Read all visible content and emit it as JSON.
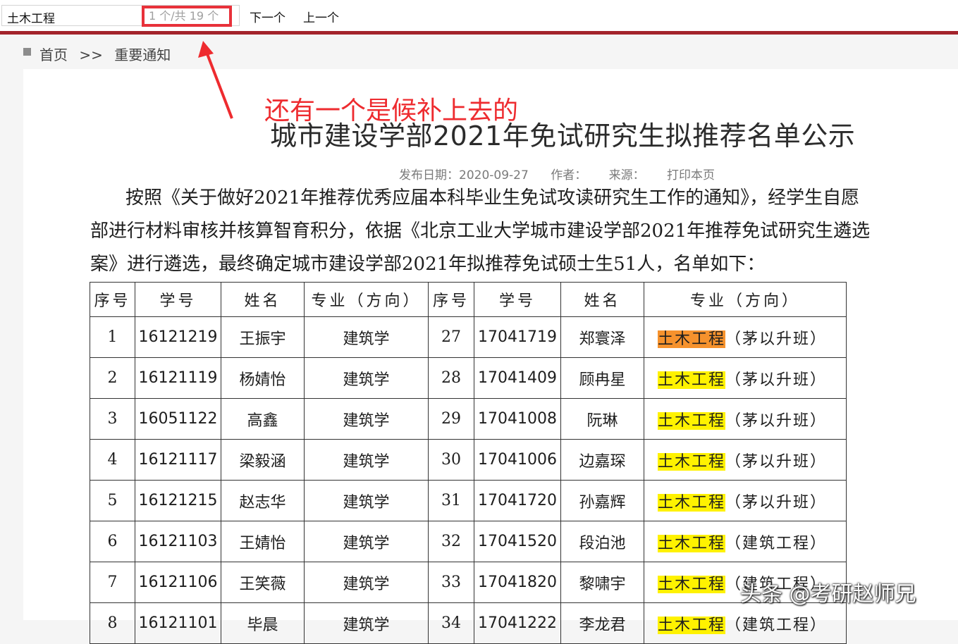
{
  "find_bar": {
    "query": "土木工程",
    "match_count": "1 个/共 19 个",
    "next_label": "下一个",
    "prev_label": "上一个"
  },
  "breadcrumb": {
    "home": "首页",
    "separator": ">>",
    "current": "重要通知"
  },
  "annotation": {
    "text": "还有一个是候补上去的",
    "color": "#ee2b2f"
  },
  "article": {
    "title": "城市建设学部2021年免试研究生拟推荐名单公示",
    "publish_date": "发布日期：2020-09-27",
    "author": "作者：",
    "source": "来源：",
    "print_label": "打印本页",
    "paragraph_lines": [
      "按照《关于做好2021年推荐优秀应届本科毕业生免试攻读研究生工作的通知》，经学生自愿",
      "部进行材料审核并核算智育积分，依据《北京工业大学城市建设学部2021年推荐免试研究生遴选",
      "案》进行遴选，最终确定城市建设学部2021年拟推荐免试硕士生51人，名单如下："
    ]
  },
  "table": {
    "headers": [
      "序号",
      "学号",
      "姓名",
      "专业（方向）",
      "序号",
      "学号",
      "姓名",
      "专业（方向）"
    ],
    "rows": [
      [
        "1",
        "16121219",
        "王振宇",
        "建筑学",
        "27",
        "17041719",
        "郑寰泽",
        "土木工程",
        "（茅以升班）"
      ],
      [
        "2",
        "16121119",
        "杨婧怡",
        "建筑学",
        "28",
        "17041409",
        "顾冉星",
        "土木工程",
        "（茅以升班）"
      ],
      [
        "3",
        "16051122",
        "高鑫",
        "建筑学",
        "29",
        "17041008",
        "阮琳",
        "土木工程",
        "（茅以升班）"
      ],
      [
        "4",
        "16121117",
        "梁毅涵",
        "建筑学",
        "30",
        "17041006",
        "边嘉琛",
        "土木工程",
        "（茅以升班）"
      ],
      [
        "5",
        "16121215",
        "赵志华",
        "建筑学",
        "31",
        "17041720",
        "孙嘉辉",
        "土木工程",
        "（茅以升班）"
      ],
      [
        "6",
        "16121103",
        "王婧怡",
        "建筑学",
        "32",
        "17041520",
        "段泊池",
        "土木工程",
        "（建筑工程）"
      ],
      [
        "7",
        "16121106",
        "王笑薇",
        "建筑学",
        "33",
        "17041820",
        "黎啸宇",
        "土木工程",
        "（建筑工程）"
      ],
      [
        "8",
        "16121101",
        "毕晨",
        "建筑学",
        "34",
        "17041222",
        "李龙君",
        "土木工程",
        "（建筑工程）"
      ]
    ],
    "current_match_color": "#f6922d",
    "match_color": "#fff200"
  },
  "watermark": "头条 @考研赵师兄"
}
